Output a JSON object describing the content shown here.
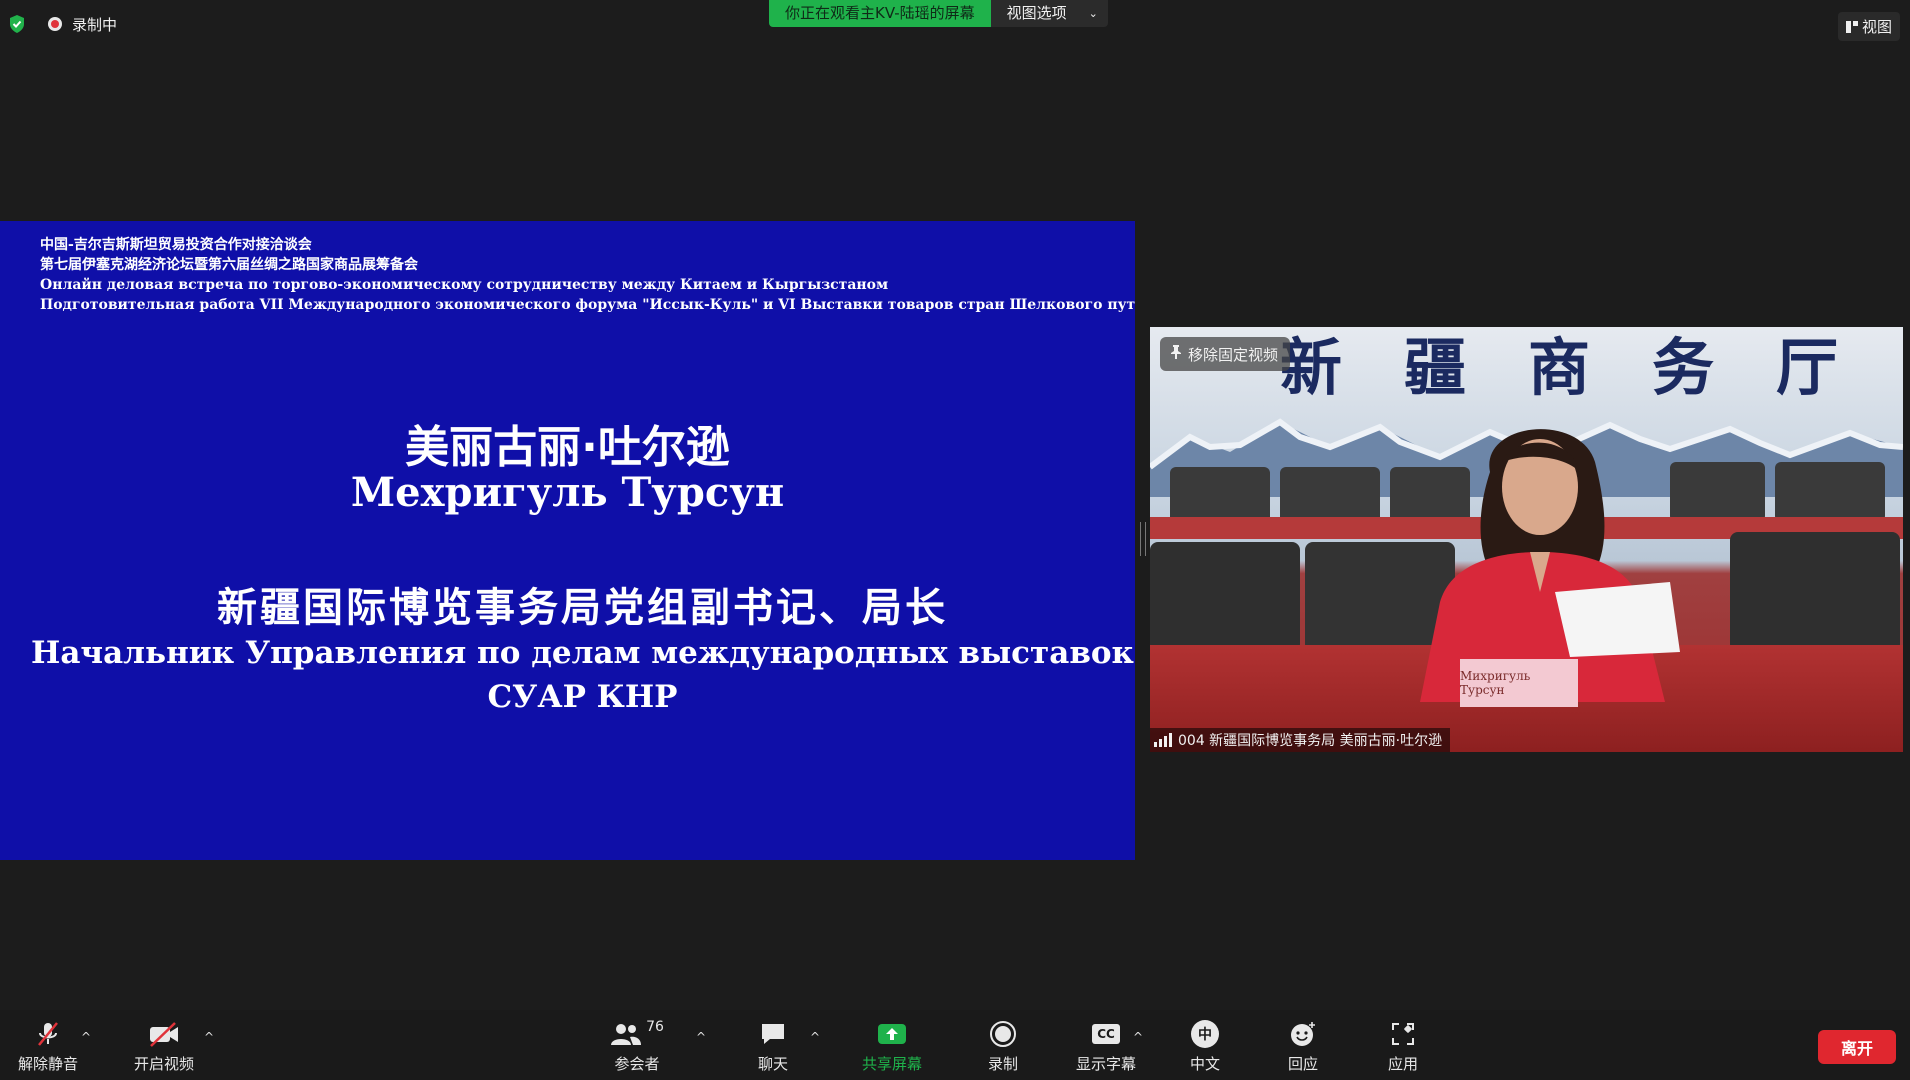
{
  "top": {
    "recording_label": "录制中",
    "share_notice": "你正在观看主KV-陆瑶的屏幕",
    "view_options": "视图选项",
    "view_button": "视图"
  },
  "slide": {
    "header_lines": [
      "中国-吉尔吉斯斯坦贸易投资合作对接洽谈会",
      "第七届伊塞克湖经济论坛暨第六届丝绸之路国家商品展筹备会",
      "Онлайн деловая встреча по торгово-экономическому сотрудничеству между Китаем и Кыргызстаном",
      " Подготовительная работа VII Международного экономического форума \"Иссык-Куль\" и VI Выставки товаров стран Шелкового пути"
    ],
    "name_zh": "美丽古丽·吐尔逊",
    "name_ru": "Мехригуль Турсун",
    "title_zh": "新疆国际博览事务局党组副书记、局长",
    "title_ru_line1": "Начальник Управления по делам международных выставок",
    "title_ru_line2": "СУАР КНР",
    "background_color": "#0f0fa8"
  },
  "video": {
    "unpin_label": "移除固定视频",
    "participant_name": "004 新疆国际博览事务局 美丽古丽·吐尔逊",
    "backdrop_text": "新疆商务厅",
    "placard_text": "Михригуль Турсун"
  },
  "toolbar": {
    "unmute": "解除静音",
    "start_video": "开启视频",
    "participants": "参会者",
    "participants_count": "76",
    "chat": "聊天",
    "share_screen": "共享屏幕",
    "record": "录制",
    "captions": "显示字幕",
    "language": "中文",
    "language_icon": "中",
    "captions_icon": "CC",
    "reactions": "回应",
    "apps": "应用",
    "leave": "离开",
    "share_color": "#1fb24b",
    "leave_color": "#e0272f"
  }
}
